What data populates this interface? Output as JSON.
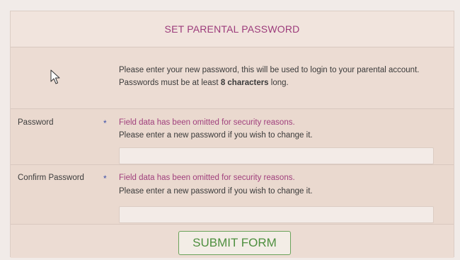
{
  "form": {
    "title": "SET PARENTAL PASSWORD",
    "intro": {
      "line1": "Please enter your new password, this will be used to login to your parental account.",
      "line2_prefix": "Passwords must be at least ",
      "line2_bold": "8 characters",
      "line2_suffix": " long."
    },
    "fields": [
      {
        "label": "Password",
        "required_marker": "*",
        "omitted_message": "Field data has been omitted for security reasons.",
        "hint": "Please enter a new password if you wish to change it.",
        "value": ""
      },
      {
        "label": "Confirm Password",
        "required_marker": "*",
        "omitted_message": "Field data has been omitted for security reasons.",
        "hint": "Please enter a new password if you wish to change it.",
        "value": ""
      }
    ],
    "submit_label": "SUBMIT FORM"
  },
  "colors": {
    "title": "#9c3b7b",
    "omitted_message": "#a0407d",
    "required_star": "#3b4fa8",
    "submit": "#4e8f3f",
    "panel_background": "#ecdfd8"
  },
  "icons": {
    "cursor": "mouse-pointer-icon"
  }
}
